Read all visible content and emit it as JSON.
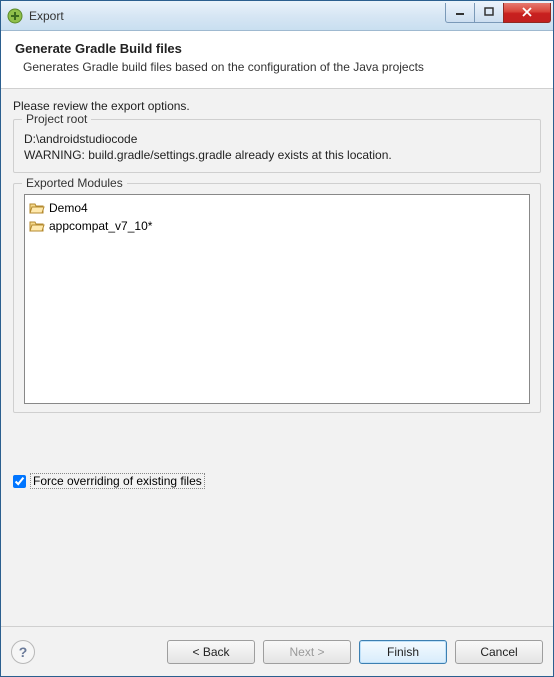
{
  "window": {
    "title": "Export"
  },
  "header": {
    "title": "Generate Gradle Build files",
    "subtitle": "Generates Gradle build files based on the configuration of the Java projects"
  },
  "content": {
    "review_text": "Please review the export options.",
    "project_root_group": {
      "label": "Project root",
      "path": "D:\\androidstudiocode",
      "warning": "WARNING: build.gradle/settings.gradle already exists at this location."
    },
    "exported_modules_group": {
      "label": "Exported Modules",
      "items": [
        {
          "name": "Demo4"
        },
        {
          "name": "appcompat_v7_10*"
        }
      ]
    },
    "force_override": {
      "checked": true,
      "label": "Force overriding of existing files"
    }
  },
  "buttons": {
    "back": "< Back",
    "next": "Next >",
    "finish": "Finish",
    "cancel": "Cancel"
  }
}
